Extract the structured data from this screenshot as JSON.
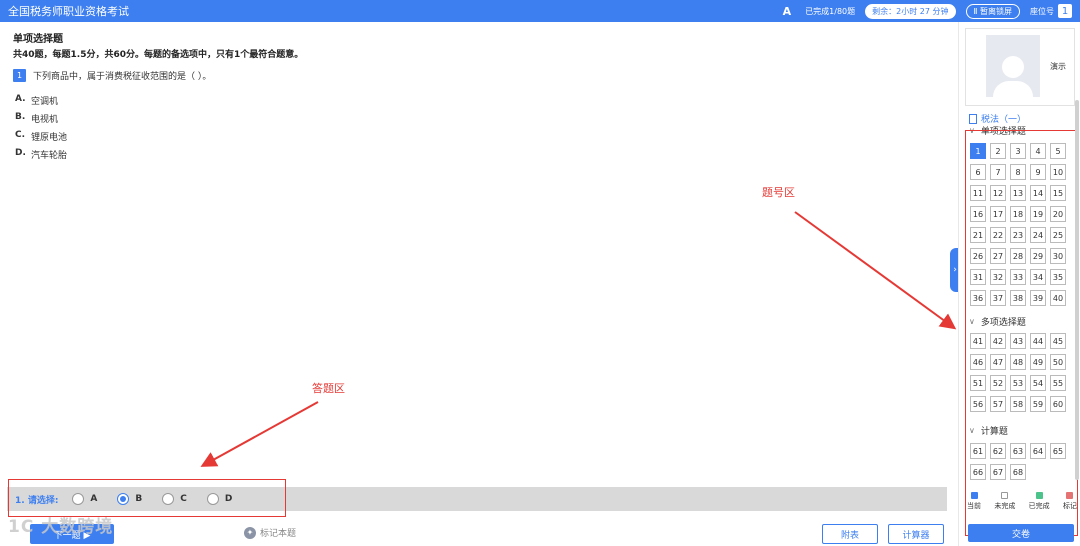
{
  "topbar": {
    "title": "全国税务师职业资格考试",
    "font_icon": "A",
    "progress": "已完成1/80题",
    "remaining": "剩余：2小时 27 分钟",
    "pause": "Ⅱ 暂离锁屏",
    "seat_label": "座位号",
    "seat_number": "1"
  },
  "question": {
    "section_title": "单项选择题",
    "section_desc": "共40题，每题1.5分，共60分。每题的备选项中，只有1个最符合题意。",
    "number": "1",
    "stem": "下列商品中，属于消费税征收范围的是（      ）。",
    "options": [
      {
        "letter": "A.",
        "text": "空调机"
      },
      {
        "letter": "B.",
        "text": "电视机"
      },
      {
        "letter": "C.",
        "text": "锂原电池"
      },
      {
        "letter": "D.",
        "text": "汽车轮胎"
      }
    ]
  },
  "answer": {
    "label": "1. 请选择:",
    "choices": [
      "A",
      "B",
      "C",
      "D"
    ],
    "selected": "B"
  },
  "bottom": {
    "next": "下一题 ▶",
    "mark": "标记本题",
    "appendix": "附表",
    "calculator": "计算器"
  },
  "watermark": "1C  大数跨境",
  "candidate": {
    "name": "演示"
  },
  "panel": {
    "subject": "税法（一）",
    "groups": [
      {
        "title": "单项选择题",
        "numbers": [
          "1",
          "2",
          "3",
          "4",
          "5",
          "6",
          "7",
          "8",
          "9",
          "10",
          "11",
          "12",
          "13",
          "14",
          "15",
          "16",
          "17",
          "18",
          "19",
          "20",
          "21",
          "22",
          "23",
          "24",
          "25",
          "26",
          "27",
          "28",
          "29",
          "30",
          "31",
          "32",
          "33",
          "34",
          "35",
          "36",
          "37",
          "38",
          "39",
          "40"
        ]
      },
      {
        "title": "多项选择题",
        "numbers": [
          "41",
          "42",
          "43",
          "44",
          "45",
          "46",
          "47",
          "48",
          "49",
          "50",
          "51",
          "52",
          "53",
          "54",
          "55",
          "56",
          "57",
          "58",
          "59",
          "60"
        ]
      },
      {
        "title": "计算题",
        "numbers": [
          "61",
          "62",
          "63",
          "64",
          "65",
          "66",
          "67",
          "68"
        ]
      }
    ],
    "current": "1",
    "legend": [
      {
        "label": "当前",
        "color": "#3d7ff0"
      },
      {
        "label": "未完成",
        "color": "#ffffff"
      },
      {
        "label": "已完成",
        "color": "#4cc38a"
      },
      {
        "label": "标记",
        "color": "#e57373"
      }
    ],
    "submit": "交卷"
  },
  "annotations": {
    "question_zone": "题号区",
    "answer_zone": "答题区"
  }
}
